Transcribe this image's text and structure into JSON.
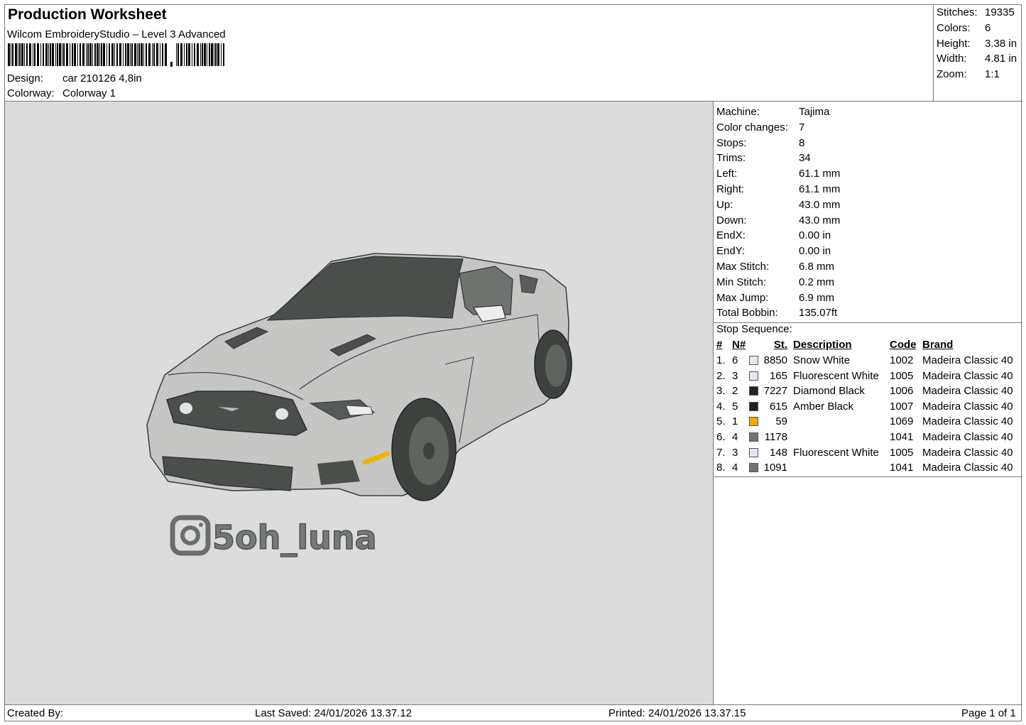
{
  "header": {
    "title": "Production Worksheet",
    "subtitle": "Wilcom EmbroideryStudio – Level 3 Advanced",
    "design_label": "Design:",
    "design_value": "car 210126 4,8in",
    "colorway_label": "Colorway:",
    "colorway_value": "Colorway 1"
  },
  "stats": [
    {
      "label": "Stitches:",
      "value": "19335"
    },
    {
      "label": "Colors:",
      "value": "6"
    },
    {
      "label": "Height:",
      "value": "3.38 in"
    },
    {
      "label": "Width:",
      "value": "4.81 in"
    },
    {
      "label": "Zoom:",
      "value": "1:1"
    }
  ],
  "design_text": "5oh_luna",
  "machine_info": [
    {
      "label": "Machine:",
      "value": "Tajima"
    },
    {
      "label": "Color changes:",
      "value": "7"
    },
    {
      "label": "Stops:",
      "value": "8"
    },
    {
      "label": "Trims:",
      "value": "34"
    },
    {
      "label": "Left:",
      "value": "61.1 mm"
    },
    {
      "label": "Right:",
      "value": "61.1 mm"
    },
    {
      "label": "Up:",
      "value": "43.0 mm"
    },
    {
      "label": "Down:",
      "value": "43.0 mm"
    },
    {
      "label": "EndX:",
      "value": "0.00 in"
    },
    {
      "label": "EndY:",
      "value": "0.00 in"
    },
    {
      "label": "Max Stitch:",
      "value": "6.8 mm"
    },
    {
      "label": "Min Stitch:",
      "value": "0.2 mm"
    },
    {
      "label": "Max Jump:",
      "value": "6.9 mm"
    },
    {
      "label": "Total Bobbin:",
      "value": "135.07ft"
    }
  ],
  "stop_sequence": {
    "title": "Stop Sequence:",
    "headers": {
      "num": "#",
      "n": "N#",
      "st": "St.",
      "desc": "Description",
      "code": "Code",
      "brand": "Brand"
    },
    "rows": [
      {
        "num": "1.",
        "n": "6",
        "color": "#e8e8ee",
        "st": "8850",
        "desc": "Snow White",
        "code": "1002",
        "brand": "Madeira Classic 40"
      },
      {
        "num": "2.",
        "n": "3",
        "color": "#e4e4f2",
        "st": "165",
        "desc": "Fluorescent White",
        "code": "1005",
        "brand": "Madeira Classic 40"
      },
      {
        "num": "3.",
        "n": "2",
        "color": "#222222",
        "st": "7227",
        "desc": "Diamond Black",
        "code": "1006",
        "brand": "Madeira Classic 40"
      },
      {
        "num": "4.",
        "n": "5",
        "color": "#1e1e1e",
        "st": "615",
        "desc": "Amber Black",
        "code": "1007",
        "brand": "Madeira Classic 40"
      },
      {
        "num": "5.",
        "n": "1",
        "color": "#f2a900",
        "st": "59",
        "desc": "",
        "code": "1069",
        "brand": "Madeira Classic 40"
      },
      {
        "num": "6.",
        "n": "4",
        "color": "#6f7470",
        "st": "1178",
        "desc": "",
        "code": "1041",
        "brand": "Madeira Classic 40"
      },
      {
        "num": "7.",
        "n": "3",
        "color": "#e4e4f2",
        "st": "148",
        "desc": "Fluorescent White",
        "code": "1005",
        "brand": "Madeira Classic 40"
      },
      {
        "num": "8.",
        "n": "4",
        "color": "#6f7470",
        "st": "1091",
        "desc": "",
        "code": "1041",
        "brand": "Madeira Classic 40"
      }
    ]
  },
  "footer": {
    "created_by": "Created By:",
    "last_saved": "Last Saved: 24/01/2026 13.37.12",
    "printed": "Printed: 24/01/2026 13.37.15",
    "page": "Page 1 of 1"
  }
}
